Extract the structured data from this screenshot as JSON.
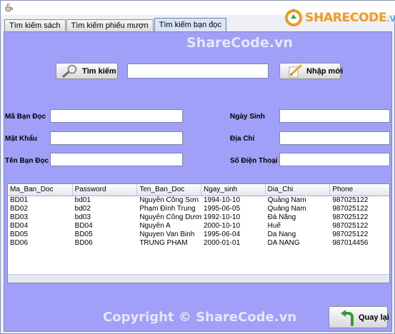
{
  "logo": {
    "text_main": "SHARECODE",
    "text_suffix": ".vn"
  },
  "tabs": [
    {
      "label": "Tìm kiếm sách",
      "active": false
    },
    {
      "label": "Tìm kiếm phiếu mượn",
      "active": false
    },
    {
      "label": "Tìm kiếm bạn đọc",
      "active": true
    }
  ],
  "search": {
    "button_label": "Tìm kiếm",
    "value": "",
    "reset_label": "Nhập mới"
  },
  "form": {
    "ma_ban_doc_label": "Mã Bạn Đọc",
    "mat_khau_label": "Mật Khẩu",
    "ten_ban_doc_label": "Tên Bạn Đọc",
    "ngay_sinh_label": "Ngày Sinh",
    "dia_chi_label": "Địa Chỉ",
    "so_dien_thoai_label": "Số Điện Thoại",
    "ma_ban_doc_value": "",
    "mat_khau_value": "",
    "ten_ban_doc_value": "",
    "ngay_sinh_value": "",
    "dia_chi_value": "",
    "so_dien_thoai_value": ""
  },
  "table": {
    "columns": [
      "Ma_Ban_Doc",
      "Password",
      "Ten_Ban_Doc",
      "Ngay_sinh",
      "Dia_Chi",
      "Phone"
    ],
    "rows": [
      [
        "BD01",
        "bd01",
        "Nguyễn Công Sơn",
        "1994-10-10",
        "Quảng Nam",
        "987025122"
      ],
      [
        "BD02",
        "bd02",
        "Phạm Đình Trung",
        "1995-06-05",
        "Quảng Nam",
        "987025122"
      ],
      [
        "BD03",
        "bd03",
        "Nguyễn Công Dương",
        "1992-10-10",
        "Đà Nẵng",
        "987025122"
      ],
      [
        "BD04",
        "BD04",
        "Nguyễn A",
        "2000-10-10",
        "Huế",
        "987025122"
      ],
      [
        "BD05",
        "BD05",
        "Nguyen Van Binh",
        "1995-06-04",
        "Da Nang",
        "987025122"
      ],
      [
        "BD06",
        "BD06",
        "TRUNG PHAM",
        "2000-01-01",
        "DA NANG",
        "987014456"
      ]
    ]
  },
  "back_button_label": "Quay lại",
  "watermarks": {
    "center": "ShareCode.vn",
    "footer": "Copyright © ShareCode.vn"
  },
  "colors": {
    "panel_bg": "#a0a0f8",
    "logo_orange": "#f29b1d",
    "logo_blue": "#2a8fcf"
  },
  "icons": {
    "search": "magnifier-icon",
    "reset": "pencil-paper-icon",
    "back": "green-back-arrow-icon",
    "app": "java-coffee-icon",
    "logo": "sharecode-logo-icon"
  }
}
